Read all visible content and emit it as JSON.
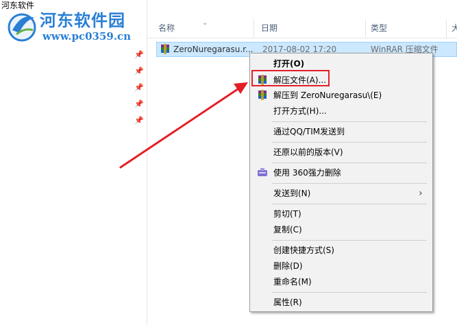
{
  "window": {
    "title": "河东软件"
  },
  "watermark": {
    "name": "河东软件园",
    "url": "www.pc0359.cn"
  },
  "header": {
    "columns": [
      {
        "label": "名称"
      },
      {
        "label": "日期"
      },
      {
        "label": "类型"
      },
      {
        "label": "大"
      }
    ]
  },
  "file": {
    "name": "ZeroNuregarasu.r...",
    "date": "2017-08-02 17:20",
    "type": "WinRAR 压缩文件"
  },
  "context_menu": {
    "items": [
      {
        "label": "打开(O)",
        "icon": "none",
        "bold": true
      },
      {
        "label": "解压文件(A)...",
        "icon": "winrar-icon",
        "highlighted": true
      },
      {
        "label": "解压到 ZeroNuregarasu\\(E)",
        "icon": "winrar-icon"
      },
      {
        "label": "打开方式(H)...",
        "icon": "none"
      },
      {
        "label": "通过QQ/TIM发送到",
        "icon": "none"
      },
      {
        "label": "还原以前的版本(V)",
        "icon": "none"
      },
      {
        "label": "使用 360强力删除",
        "icon": "360-icon"
      },
      {
        "label": "发送到(N)",
        "icon": "none",
        "submenu": true
      },
      {
        "label": "剪切(T)",
        "icon": "none"
      },
      {
        "label": "复制(C)",
        "icon": "none"
      },
      {
        "label": "创建快捷方式(S)",
        "icon": "none"
      },
      {
        "label": "删除(D)",
        "icon": "none"
      },
      {
        "label": "重命名(M)",
        "icon": "none"
      },
      {
        "label": "属性(R)",
        "icon": "none"
      }
    ]
  },
  "colors": {
    "selection": "#cce8ff",
    "highlight_box": "#e41e26",
    "arrow": "#e41e26",
    "watermark": "#2a7fd4"
  }
}
